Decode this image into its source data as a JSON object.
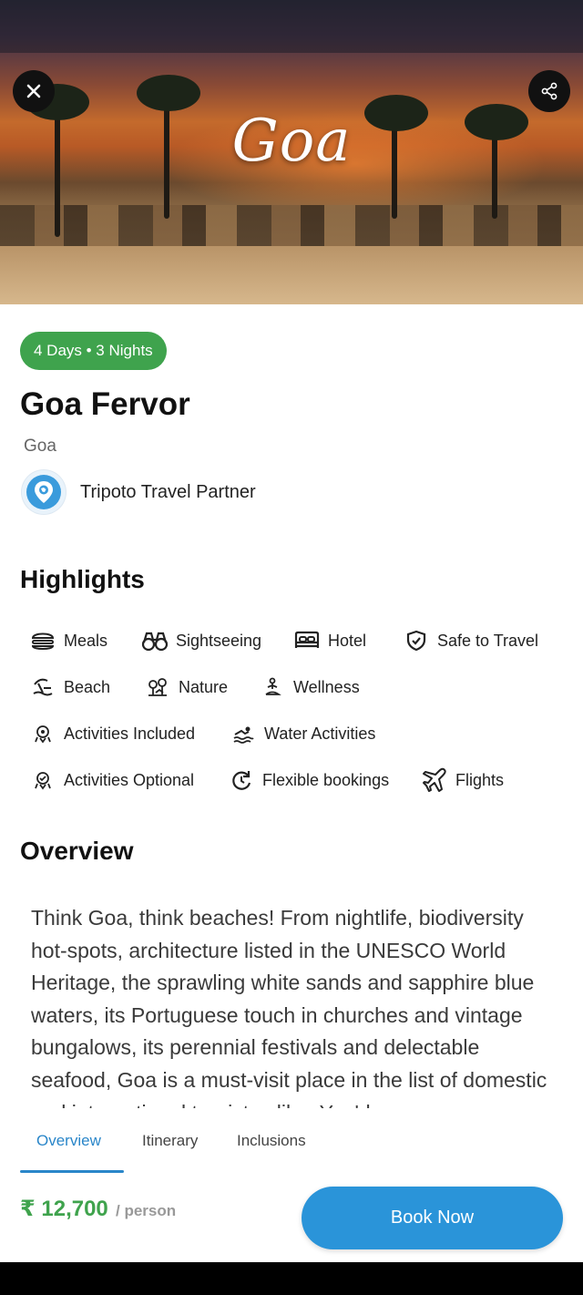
{
  "hero": {
    "title": "Goa",
    "close_icon": "close-icon",
    "share_icon": "share-icon"
  },
  "package": {
    "duration": "4 Days • 3 Nights",
    "title": "Goa Fervor",
    "location": "Goa",
    "partner": "Tripoto Travel Partner"
  },
  "highlights": {
    "heading": "Highlights",
    "items": [
      {
        "label": "Meals",
        "icon": "meals-icon"
      },
      {
        "label": "Sightseeing",
        "icon": "binoculars-icon"
      },
      {
        "label": "Hotel",
        "icon": "bed-icon"
      },
      {
        "label": "Safe to Travel",
        "icon": "shield-check-icon"
      },
      {
        "label": "Beach",
        "icon": "beach-icon"
      },
      {
        "label": "Nature",
        "icon": "nature-icon"
      },
      {
        "label": "Wellness",
        "icon": "meditation-icon"
      },
      {
        "label": "Activities Included",
        "icon": "activity-icon"
      },
      {
        "label": "Water Activities",
        "icon": "swimming-icon"
      },
      {
        "label": "Activities Optional",
        "icon": "activity-optional-icon"
      },
      {
        "label": "Flexible bookings",
        "icon": "refresh-icon"
      },
      {
        "label": "Flights",
        "icon": "airplane-icon"
      }
    ]
  },
  "overview": {
    "heading": "Overview",
    "text": "Think Goa, think beaches! From nightlife, biodiversity hot-spots, architecture listed in the UNESCO World Heritage, the sprawling white sands and sapphire blue waters, its Portuguese touch in churches and vintage bungalows, its perennial festivals and delectable seafood, Goa is a must-visit place in the list of domestic and international tourists alike. You'd"
  },
  "tabs": [
    {
      "label": "Overview",
      "active": true
    },
    {
      "label": "Itinerary",
      "active": false
    },
    {
      "label": "Inclusions",
      "active": false
    }
  ],
  "footer": {
    "price": "₹ 12,700",
    "per": "/ person",
    "book_label": "Book Now"
  },
  "colors": {
    "green": "#3fa34d",
    "blue": "#2a94d9",
    "tab_active": "#2a86c9"
  }
}
